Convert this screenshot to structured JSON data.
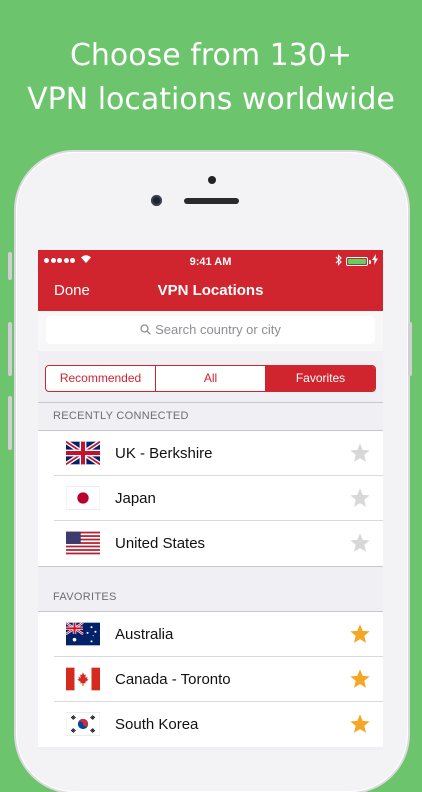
{
  "headline": {
    "line1": "Choose from 130+",
    "line2": "VPN locations worldwide"
  },
  "status_bar": {
    "time": "9:41 AM"
  },
  "nav": {
    "done_label": "Done",
    "title": "VPN Locations"
  },
  "search": {
    "placeholder": "Search country or city"
  },
  "segments": {
    "recommended": "Recommended",
    "all": "All",
    "favorites": "Favorites",
    "selected": "Favorites"
  },
  "recently_connected": {
    "header": "RECENTLY CONNECTED",
    "items": [
      {
        "name": "UK - Berkshire",
        "flag": "uk-flag-icon",
        "favorite": false
      },
      {
        "name": "Japan",
        "flag": "japan-flag-icon",
        "favorite": false
      },
      {
        "name": "United States",
        "flag": "us-flag-icon",
        "favorite": false
      }
    ]
  },
  "favorites": {
    "header": "FAVORITES",
    "items": [
      {
        "name": "Australia",
        "flag": "australia-flag-icon",
        "favorite": true
      },
      {
        "name": "Canada - Toronto",
        "flag": "canada-flag-icon",
        "favorite": true
      },
      {
        "name": "South Korea",
        "flag": "south-korea-flag-icon",
        "favorite": true
      }
    ]
  },
  "colors": {
    "background": "#6cc46d",
    "brand_red": "#d0252f",
    "star_active": "#f5a623",
    "star_inactive": "#d8d8d8"
  }
}
